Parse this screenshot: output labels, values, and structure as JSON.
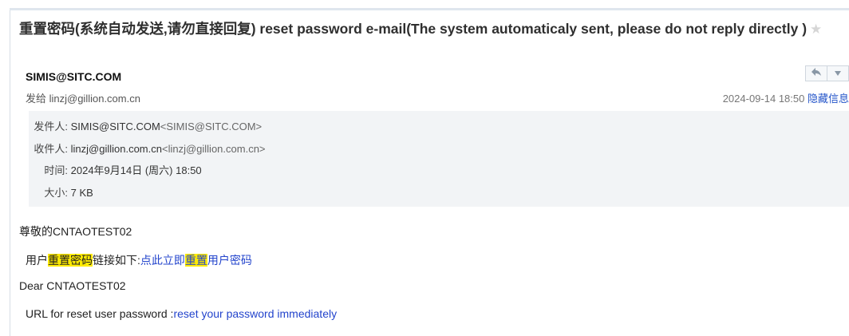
{
  "email": {
    "subject": "重置密码(系统自动发送,请勿直接回复) reset password e-mail(The system automaticaly sent, please do not reply directly )",
    "star_icon": "star-icon",
    "sender": "SIMIS@SITC.COM",
    "sent_to": "发给 linzj@gillion.com.cn",
    "datetime": "2024-09-14 18:50",
    "hide_info": "隐藏信息",
    "toolbar": {
      "reply_icon": "reply-icon",
      "more_icon": "chevron-down-icon"
    }
  },
  "details": {
    "from_label": "发件人:",
    "from_value": "SIMIS@SITC.COM",
    "from_addr": "<SIMIS@SITC.COM>",
    "to_label": "收件人:",
    "to_value": "linzj@gillion.com.cn",
    "to_addr": "<linzj@gillion.com.cn>",
    "time_label": "时间:",
    "time_value": "2024年9月14日 (周六) 18:50",
    "size_label": "大小:",
    "size_value": "7 KB"
  },
  "body": {
    "greeting_cn": "尊敬的CNTAOTEST02",
    "line2_prefix": "用户",
    "line2_highlight": "重置密码",
    "line2_mid": "链接如下:",
    "link_cn_a": "点此立即",
    "link_cn_highlight": "重置",
    "link_cn_b": "用户密码",
    "greeting_en": "Dear CNTAOTEST02",
    "url_label": "URL for reset user password :",
    "link_en": "reset your password immediately"
  },
  "colors": {
    "highlight": "#ffeb00",
    "link": "#2344cc",
    "details_bg": "#f2f4f6"
  }
}
